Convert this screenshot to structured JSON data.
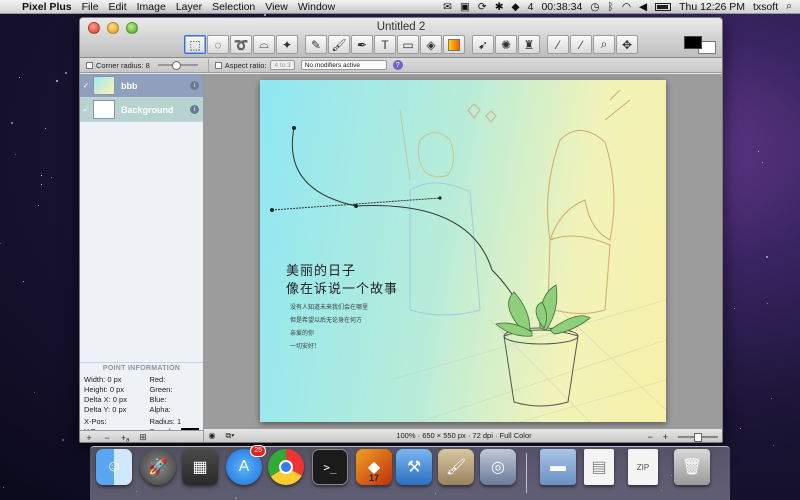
{
  "menubar": {
    "app_name": "Pixel Plus",
    "menus": [
      "File",
      "Edit",
      "Image",
      "Layer",
      "Selection",
      "View",
      "Window"
    ],
    "status_items": [
      "4",
      "00:38:34"
    ],
    "clock": "Thu 12:26 PM",
    "user": "txsoft"
  },
  "window": {
    "title": "Untitled 2"
  },
  "options": {
    "corner_radius_label": "Corner radius: 8",
    "aspect_ratio_label": "Aspect ratio:",
    "aspect_ratio_value": "4 to 3",
    "modifier_value": "No modifiers active",
    "help": "?"
  },
  "layers": [
    {
      "name": "bbb",
      "selected": true
    },
    {
      "name": "Background",
      "selected": false
    }
  ],
  "point_info": {
    "title": "POINT INFORMATION",
    "left": [
      {
        "label": "Width:",
        "value": "0 px"
      },
      {
        "label": "Height:",
        "value": "0 px"
      },
      {
        "label": "Delta X:",
        "value": "0 px"
      },
      {
        "label": "Delta Y:",
        "value": "0 px"
      },
      {
        "label": "X-Pos:",
        "value": ""
      },
      {
        "label": "Y-Pos:",
        "value": ""
      }
    ],
    "right": [
      {
        "label": "Red:",
        "value": ""
      },
      {
        "label": "Green:",
        "value": ""
      },
      {
        "label": "Blue:",
        "value": ""
      },
      {
        "label": "Alpha:",
        "value": ""
      },
      {
        "label": "Radius:",
        "value": "1"
      },
      {
        "label": "Sample:",
        "value": ""
      }
    ]
  },
  "sidebar_footer": [
    "+",
    "−",
    "+ₐ",
    "⊞"
  ],
  "artwork_text": {
    "line1": "美丽的日子",
    "line2": "像在诉说一个故事",
    "small": [
      "没有人知道未来我们会在哪里",
      "但是希望以后无论身在何方",
      "亲爱的你",
      "一切安好!"
    ]
  },
  "status": {
    "text": "100% · 650 × 550 px · 72 dpi · Full Color",
    "zoom_out": "−",
    "zoom_in": "+"
  },
  "dock": {
    "app_store_badge": "25",
    "calendar_day": "17"
  },
  "colors": {
    "foreground": "#000000",
    "background": "#ffffff",
    "layer_selected": "#8fa0bf"
  }
}
